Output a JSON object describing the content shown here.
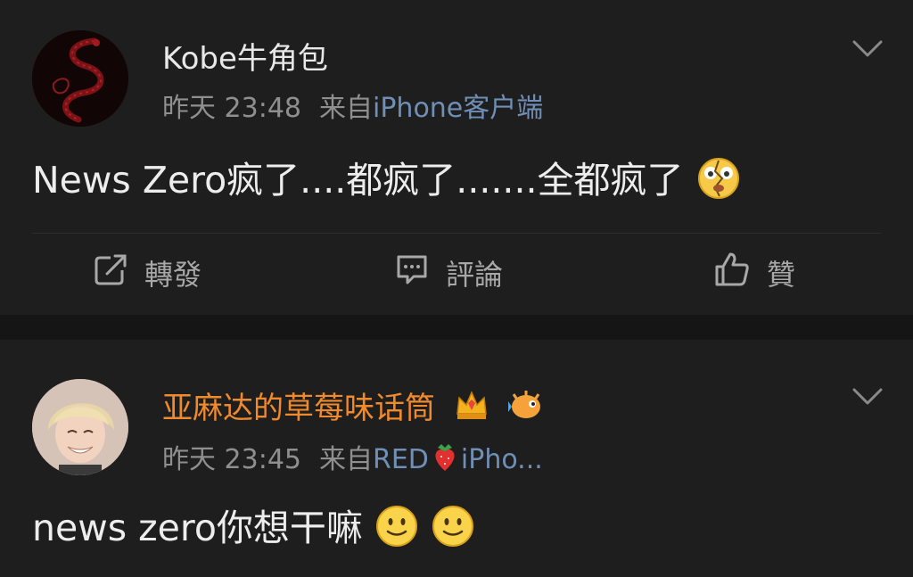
{
  "posts": [
    {
      "username": "Kobe牛角包",
      "time": "昨天 23:48",
      "source_prefix": "来自",
      "source": "iPhone客户端",
      "content": "News Zero疯了....都疯了.......全都疯了",
      "avatar": "red-snake-avatar",
      "emoji": "broken-face-emoji",
      "actions": {
        "repost": "轉發",
        "comment": "評論",
        "like": "贊"
      }
    },
    {
      "username": "亚麻达的草莓味话筒",
      "time": "昨天 23:45",
      "source_prefix": "来自",
      "source_a": "RED",
      "source_b": "iPho...",
      "content": "news zero你想干嘛",
      "avatar": "smiling-person-avatar",
      "badges": [
        "crown-badge-icon",
        "pufferfish-badge-icon"
      ],
      "emoji": "smile-emoji"
    }
  ],
  "colors": {
    "background": "#1e1e1e",
    "separator": "#151515",
    "username_default": "#e8e8e8",
    "username_vip": "#f08a2c",
    "meta": "#8f8f8f",
    "source_link": "#6f8fb6"
  }
}
